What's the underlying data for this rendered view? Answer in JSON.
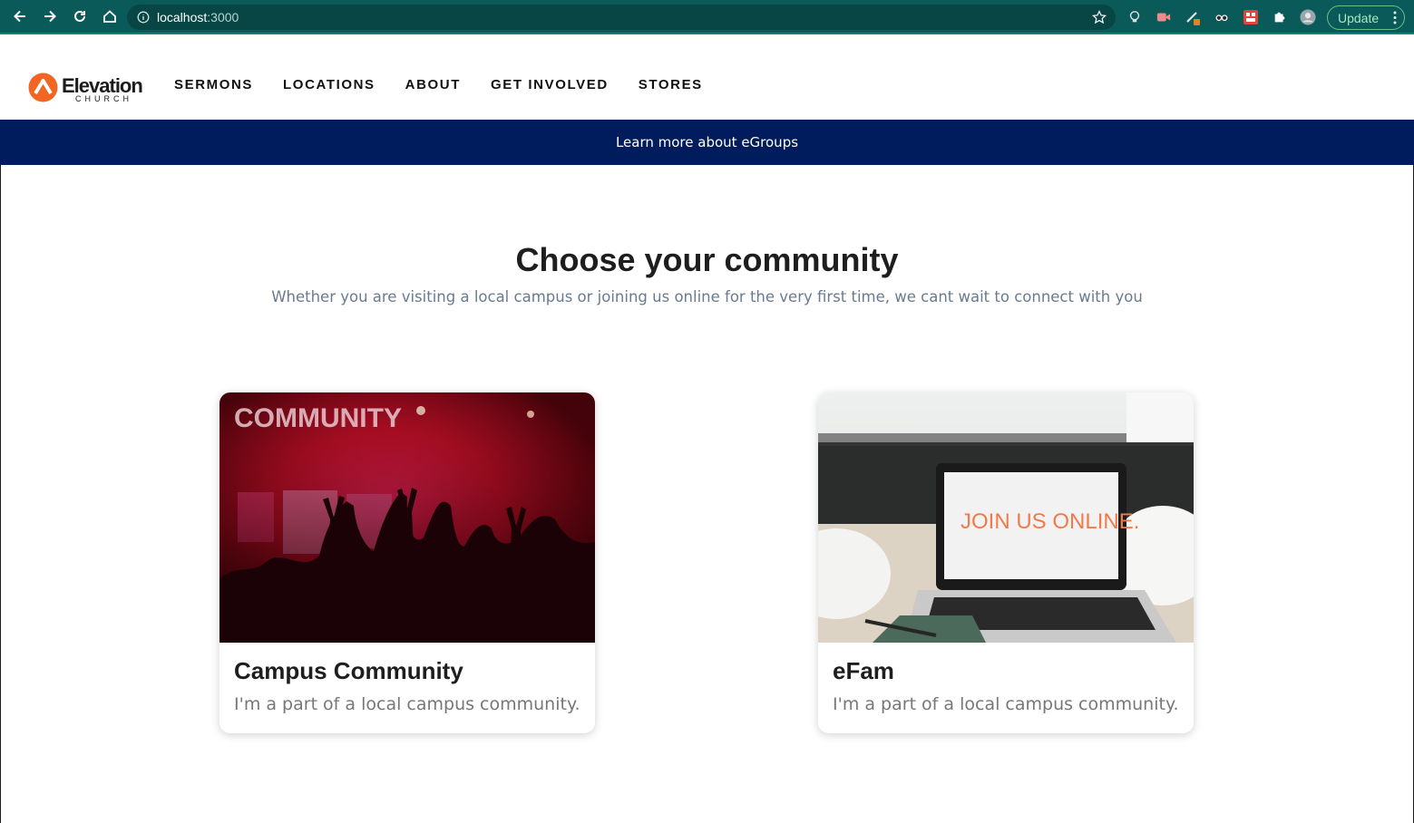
{
  "browser": {
    "url_host": "localhost",
    "url_port": ":3000",
    "update_label": "Update"
  },
  "site": {
    "logo_word": "Elevation",
    "logo_sub": "CHURCH",
    "nav": [
      "SERMONS",
      "LOCATIONS",
      "ABOUT",
      "GET INVOLVED",
      "STORES"
    ],
    "banner_link": "Learn more about eGroups"
  },
  "main": {
    "title": "Choose your community",
    "subtitle": "Whether you are visiting a local campus or joining us online for the very first time, we cant wait to connect with you",
    "cards": [
      {
        "title": "Campus Community",
        "description": "I'm a part of a local campus community.",
        "image_text": "COMMUNITY"
      },
      {
        "title": "eFam",
        "description": "I'm a part of a local campus community.",
        "image_text": "JOIN US ONLINE."
      }
    ]
  },
  "colors": {
    "chrome_bg": "#0b5a5a",
    "banner_bg": "#001c5c",
    "logo_orange": "#f26522"
  }
}
